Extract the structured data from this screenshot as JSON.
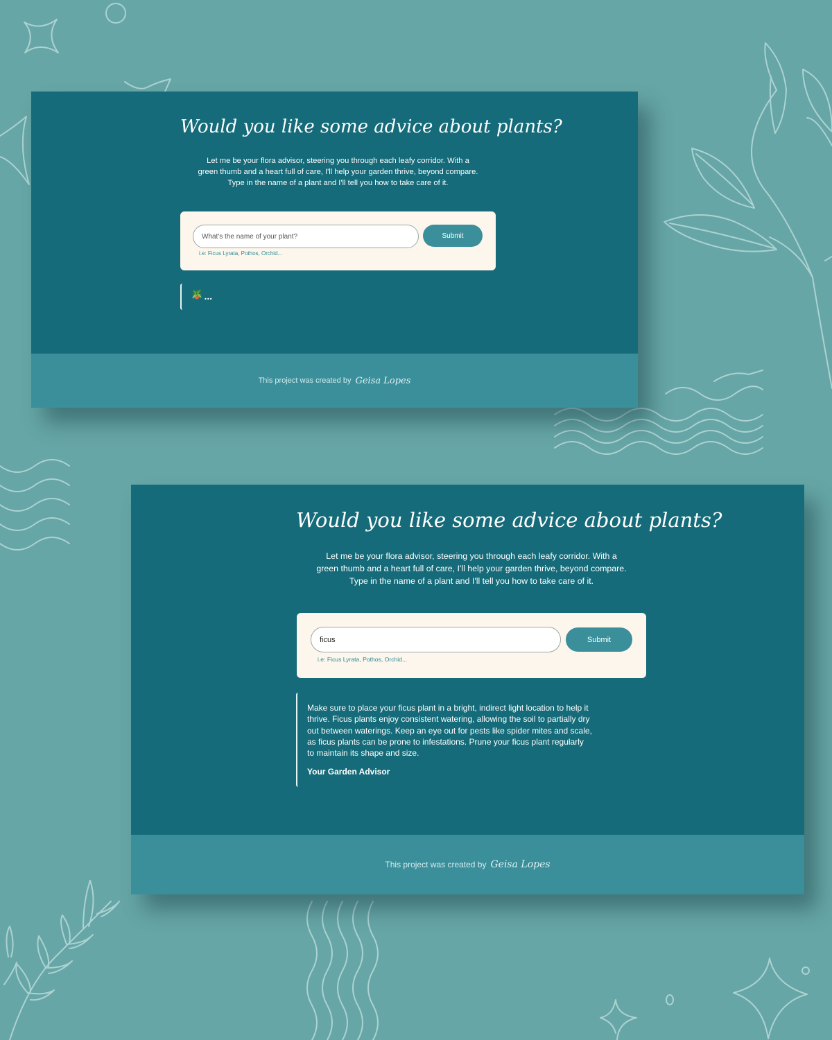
{
  "screens": [
    {
      "title": "Would you like some advice about plants?",
      "description_lines": [
        "Let me be your flora advisor, steering you through each leafy corridor. With a",
        "green thumb and a heart full of care, I'll help your garden thrive, beyond compare.",
        "Type in the name of a plant and I'll tell you how to take care of it."
      ],
      "input_value": "",
      "input_placeholder": "What's the name of your plant?",
      "submit_label": "Submit",
      "hint": "i.e: Ficus Lyrata, Pothos, Orchid...",
      "loading_icon": "🪴",
      "loading_text": "...",
      "footer_text": "This project was created by",
      "footer_author": "Geisa Lopes"
    },
    {
      "title": "Would you like some advice about plants?",
      "description_lines": [
        "Let me be your flora advisor, steering you through each leafy corridor. With a",
        "green thumb and a heart full of care, I'll help your garden thrive, beyond compare.",
        "Type in the name of a plant and I'll tell you how to take care of it."
      ],
      "input_value": "ficus",
      "input_placeholder": "What's the name of your plant?",
      "submit_label": "Submit",
      "hint": "i.e: Ficus Lyrata, Pothos, Orchid...",
      "answer_lines": [
        "Make sure to place your ficus plant in a bright, indirect light location to help it",
        "thrive. Ficus plants enjoy consistent watering, allowing the soil to partially dry",
        "out between waterings. Keep an eye out for pests like spider mites and scale,",
        "as ficus plants can be prone to infestations. Prune your ficus plant regularly",
        "to maintain its shape and size."
      ],
      "answer_signature": "Your Garden Advisor",
      "footer_text": "This project was created by",
      "footer_author": "Geisa Lopes"
    }
  ],
  "colors": {
    "background": "#67a6a6",
    "panel": "#156b79",
    "footer": "#3a8f9a",
    "form": "#fdf6ec",
    "button": "#3a8f9a",
    "line_art": "#b9dada"
  },
  "icons": [
    "potted-plant-icon",
    "leaf-branch-decoration",
    "wave-lines-decoration",
    "sparkle-decoration",
    "circle-decoration"
  ]
}
